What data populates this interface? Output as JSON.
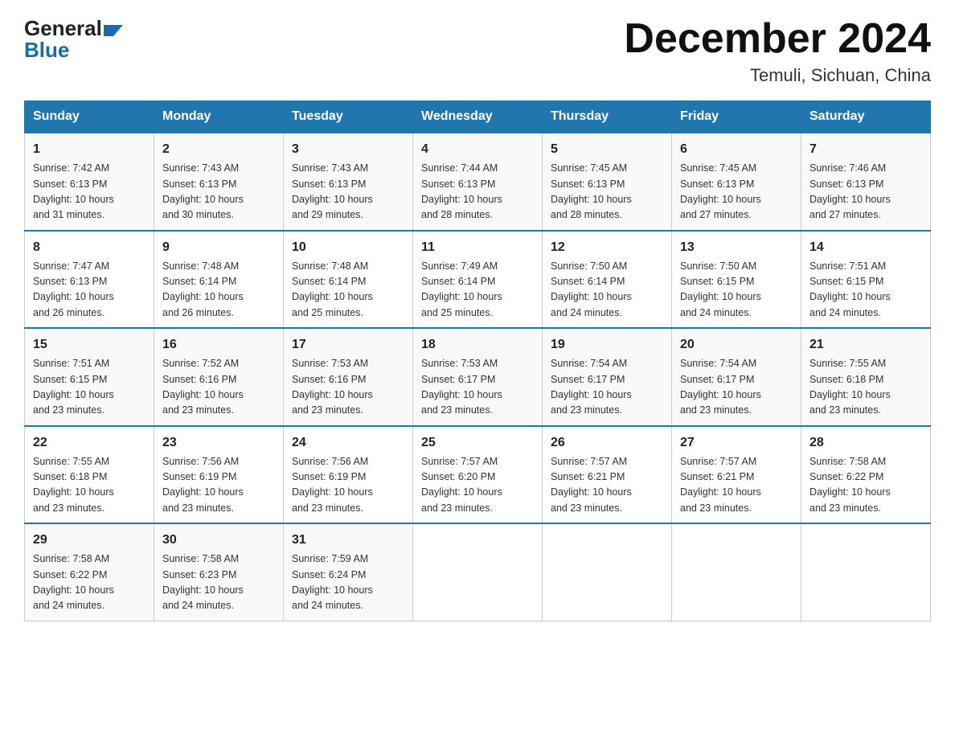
{
  "header": {
    "logo_general": "General",
    "logo_blue": "Blue",
    "month_title": "December 2024",
    "location": "Temuli, Sichuan, China"
  },
  "weekdays": [
    "Sunday",
    "Monday",
    "Tuesday",
    "Wednesday",
    "Thursday",
    "Friday",
    "Saturday"
  ],
  "weeks": [
    [
      {
        "day": "1",
        "sunrise": "7:42 AM",
        "sunset": "6:13 PM",
        "daylight": "10 hours and 31 minutes."
      },
      {
        "day": "2",
        "sunrise": "7:43 AM",
        "sunset": "6:13 PM",
        "daylight": "10 hours and 30 minutes."
      },
      {
        "day": "3",
        "sunrise": "7:43 AM",
        "sunset": "6:13 PM",
        "daylight": "10 hours and 29 minutes."
      },
      {
        "day": "4",
        "sunrise": "7:44 AM",
        "sunset": "6:13 PM",
        "daylight": "10 hours and 28 minutes."
      },
      {
        "day": "5",
        "sunrise": "7:45 AM",
        "sunset": "6:13 PM",
        "daylight": "10 hours and 28 minutes."
      },
      {
        "day": "6",
        "sunrise": "7:45 AM",
        "sunset": "6:13 PM",
        "daylight": "10 hours and 27 minutes."
      },
      {
        "day": "7",
        "sunrise": "7:46 AM",
        "sunset": "6:13 PM",
        "daylight": "10 hours and 27 minutes."
      }
    ],
    [
      {
        "day": "8",
        "sunrise": "7:47 AM",
        "sunset": "6:13 PM",
        "daylight": "10 hours and 26 minutes."
      },
      {
        "day": "9",
        "sunrise": "7:48 AM",
        "sunset": "6:14 PM",
        "daylight": "10 hours and 26 minutes."
      },
      {
        "day": "10",
        "sunrise": "7:48 AM",
        "sunset": "6:14 PM",
        "daylight": "10 hours and 25 minutes."
      },
      {
        "day": "11",
        "sunrise": "7:49 AM",
        "sunset": "6:14 PM",
        "daylight": "10 hours and 25 minutes."
      },
      {
        "day": "12",
        "sunrise": "7:50 AM",
        "sunset": "6:14 PM",
        "daylight": "10 hours and 24 minutes."
      },
      {
        "day": "13",
        "sunrise": "7:50 AM",
        "sunset": "6:15 PM",
        "daylight": "10 hours and 24 minutes."
      },
      {
        "day": "14",
        "sunrise": "7:51 AM",
        "sunset": "6:15 PM",
        "daylight": "10 hours and 24 minutes."
      }
    ],
    [
      {
        "day": "15",
        "sunrise": "7:51 AM",
        "sunset": "6:15 PM",
        "daylight": "10 hours and 23 minutes."
      },
      {
        "day": "16",
        "sunrise": "7:52 AM",
        "sunset": "6:16 PM",
        "daylight": "10 hours and 23 minutes."
      },
      {
        "day": "17",
        "sunrise": "7:53 AM",
        "sunset": "6:16 PM",
        "daylight": "10 hours and 23 minutes."
      },
      {
        "day": "18",
        "sunrise": "7:53 AM",
        "sunset": "6:17 PM",
        "daylight": "10 hours and 23 minutes."
      },
      {
        "day": "19",
        "sunrise": "7:54 AM",
        "sunset": "6:17 PM",
        "daylight": "10 hours and 23 minutes."
      },
      {
        "day": "20",
        "sunrise": "7:54 AM",
        "sunset": "6:17 PM",
        "daylight": "10 hours and 23 minutes."
      },
      {
        "day": "21",
        "sunrise": "7:55 AM",
        "sunset": "6:18 PM",
        "daylight": "10 hours and 23 minutes."
      }
    ],
    [
      {
        "day": "22",
        "sunrise": "7:55 AM",
        "sunset": "6:18 PM",
        "daylight": "10 hours and 23 minutes."
      },
      {
        "day": "23",
        "sunrise": "7:56 AM",
        "sunset": "6:19 PM",
        "daylight": "10 hours and 23 minutes."
      },
      {
        "day": "24",
        "sunrise": "7:56 AM",
        "sunset": "6:19 PM",
        "daylight": "10 hours and 23 minutes."
      },
      {
        "day": "25",
        "sunrise": "7:57 AM",
        "sunset": "6:20 PM",
        "daylight": "10 hours and 23 minutes."
      },
      {
        "day": "26",
        "sunrise": "7:57 AM",
        "sunset": "6:21 PM",
        "daylight": "10 hours and 23 minutes."
      },
      {
        "day": "27",
        "sunrise": "7:57 AM",
        "sunset": "6:21 PM",
        "daylight": "10 hours and 23 minutes."
      },
      {
        "day": "28",
        "sunrise": "7:58 AM",
        "sunset": "6:22 PM",
        "daylight": "10 hours and 23 minutes."
      }
    ],
    [
      {
        "day": "29",
        "sunrise": "7:58 AM",
        "sunset": "6:22 PM",
        "daylight": "10 hours and 24 minutes."
      },
      {
        "day": "30",
        "sunrise": "7:58 AM",
        "sunset": "6:23 PM",
        "daylight": "10 hours and 24 minutes."
      },
      {
        "day": "31",
        "sunrise": "7:59 AM",
        "sunset": "6:24 PM",
        "daylight": "10 hours and 24 minutes."
      },
      null,
      null,
      null,
      null
    ]
  ],
  "labels": {
    "sunrise": "Sunrise:",
    "sunset": "Sunset:",
    "daylight": "Daylight:"
  }
}
